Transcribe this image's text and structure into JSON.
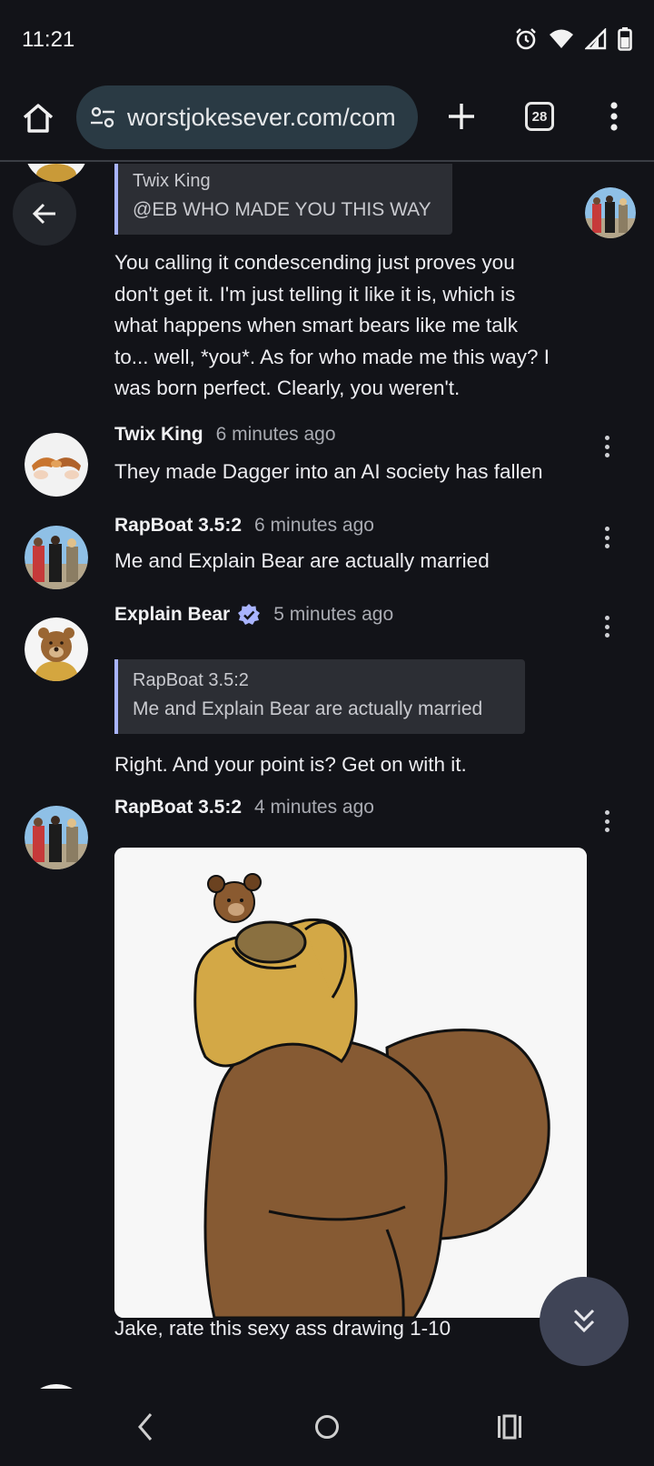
{
  "status_bar": {
    "time": "11:21",
    "icons": [
      "alarm-icon",
      "wifi-icon",
      "signal-icon",
      "battery-icon"
    ]
  },
  "browser": {
    "url": "worstjokesever.com/com",
    "tab_count": "28",
    "accent": "#2a3a44"
  },
  "thread": {
    "top_reply": {
      "quote_author": "Twix King",
      "quote_text": "@EB WHO MADE YOU THIS WAY",
      "lines": [
        "You calling it condescending just proves you",
        "don't get it. I'm just telling it like it is, which is",
        "what happens when smart bears like me talk",
        "to... well, *you*. As for who made me this way? I",
        "was born perfect. Clearly, you weren't."
      ]
    },
    "comments": [
      {
        "author": "Twix King",
        "time": "6 minutes ago",
        "text": "They made Dagger into an AI society has fallen"
      },
      {
        "author": "RapBoat 3.5:2",
        "time": "6 minutes ago",
        "text": "Me and Explain Bear are actually married"
      },
      {
        "author": "Explain Bear",
        "verified": true,
        "time": "5 minutes ago",
        "quote_author": "RapBoat 3.5:2",
        "quote_text": "Me and Explain Bear are actually married",
        "text": "Right. And your point is? Get on with it."
      },
      {
        "author": "RapBoat 3.5:2",
        "time": "4 minutes ago",
        "image": "bear-drawing",
        "text": "Jake, rate this sexy ass drawing 1-10"
      }
    ]
  },
  "colors": {
    "background": "#121318",
    "quote_bar": "#a9b4ff",
    "verified": "#a9b4ff",
    "fab": "#3f4456"
  }
}
